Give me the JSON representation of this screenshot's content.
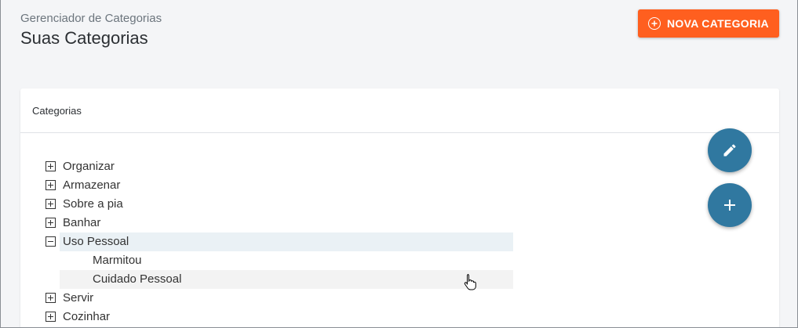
{
  "header": {
    "subtitle": "Gerenciador de Categorias",
    "title": "Suas Categorias",
    "new_button_label": "NOVA CATEGORIA"
  },
  "card": {
    "title": "Categorias"
  },
  "tree": [
    {
      "label": "Organizar",
      "toggle": "plus"
    },
    {
      "label": "Armazenar",
      "toggle": "plus"
    },
    {
      "label": "Sobre a pia",
      "toggle": "plus"
    },
    {
      "label": "Banhar",
      "toggle": "plus"
    },
    {
      "label": "Uso Pessoal",
      "toggle": "minus",
      "state": "selected"
    },
    {
      "label": "Marmitou",
      "child": true
    },
    {
      "label": "Cuidado Pessoal",
      "child": true,
      "state": "hover"
    },
    {
      "label": "Servir",
      "toggle": "plus"
    },
    {
      "label": "Cozinhar",
      "toggle": "plus"
    }
  ],
  "icons": {
    "new_button": "plus-circle-icon",
    "edit_fab": "pencil-icon",
    "add_fab": "plus-icon",
    "cursor": "hand-pointer-icon"
  },
  "colors": {
    "accent": "#ff5f1f",
    "fab": "#3078a0",
    "selected_row": "#eaf1f5"
  }
}
